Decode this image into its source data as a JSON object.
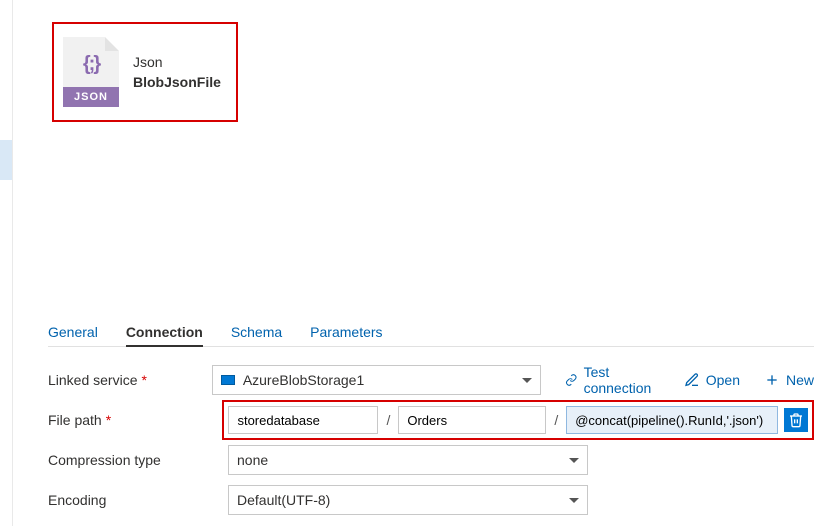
{
  "card": {
    "format": "Json",
    "name": "BlobJsonFile",
    "icon_braces": "{;}",
    "icon_band": "JSON"
  },
  "tabs": {
    "general": "General",
    "connection": "Connection",
    "schema": "Schema",
    "parameters": "Parameters"
  },
  "form": {
    "linked_service_label": "Linked service",
    "linked_service_value": "AzureBlobStorage1",
    "file_path_label": "File path",
    "fp_container": "storedatabase",
    "fp_directory": "Orders",
    "fp_file": "@concat(pipeline().RunId,'.json')",
    "compression_label": "Compression type",
    "compression_value": "none",
    "encoding_label": "Encoding",
    "encoding_value": "Default(UTF-8)",
    "separator": "/"
  },
  "actions": {
    "test": "Test connection",
    "open": "Open",
    "new": "New"
  },
  "required_marker": "*"
}
